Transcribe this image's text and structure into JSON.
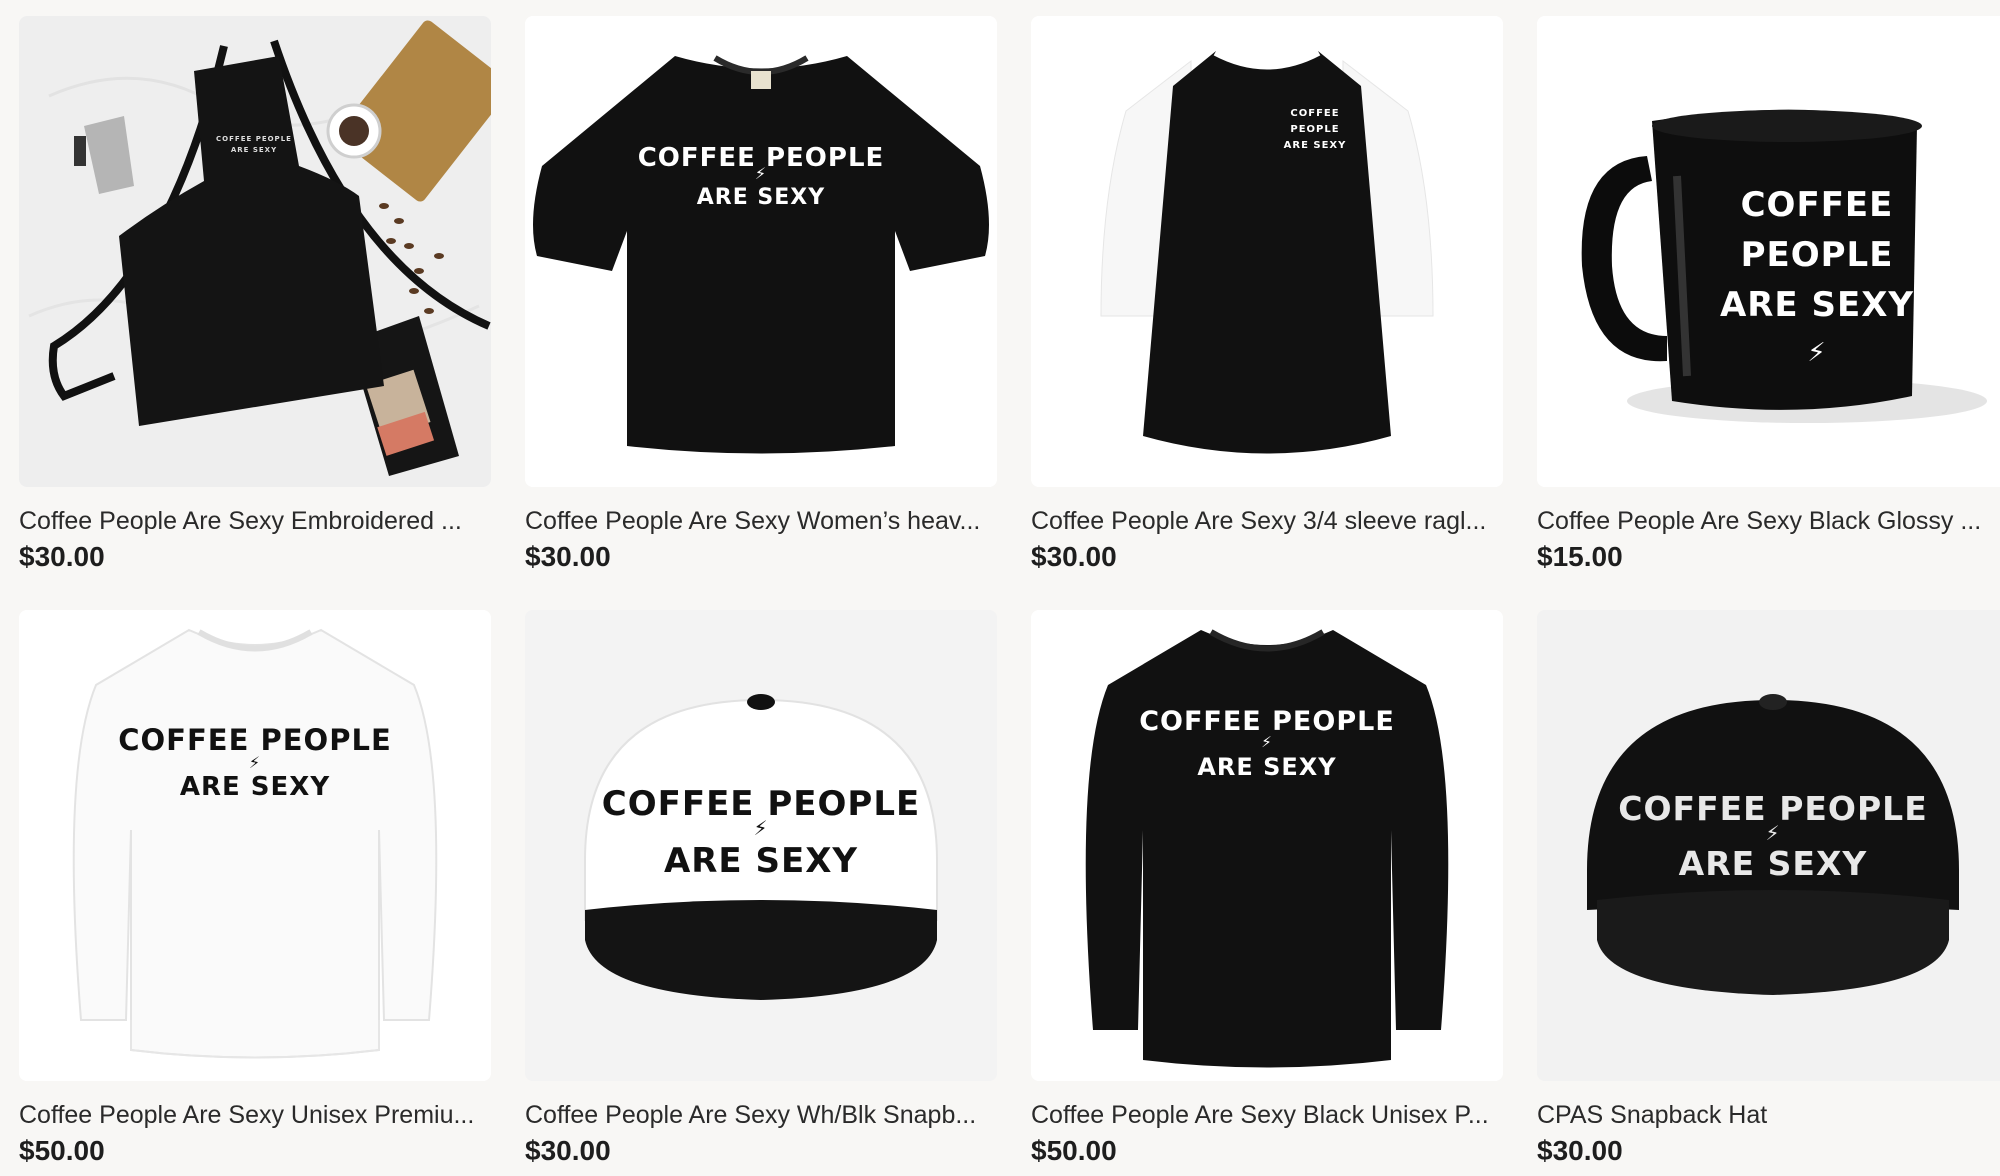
{
  "products": [
    {
      "title": "Coffee People Are Sexy Embroidered ...",
      "price": "$30.00",
      "icon": "apron-image",
      "print": [
        "COFFEE PEOPLE",
        "ARE SEXY"
      ]
    },
    {
      "title": "Coffee People Are Sexy Women’s heav...",
      "price": "$30.00",
      "icon": "tshirt-image",
      "print": [
        "COFFEE PEOPLE",
        "ARE SEXY"
      ]
    },
    {
      "title": "Coffee People Are Sexy 3/4 sleeve ragl...",
      "price": "$30.00",
      "icon": "raglan-shirt-image",
      "print": [
        "COFFEE",
        "PEOPLE",
        "ARE SEXY"
      ]
    },
    {
      "title": "Coffee People Are Sexy Black Glossy ...",
      "price": "$15.00",
      "icon": "mug-image",
      "print": [
        "COFFEE",
        "PEOPLE",
        "ARE SEXY"
      ]
    },
    {
      "title": "Coffee People Are Sexy Unisex Premiu...",
      "price": "$50.00",
      "icon": "white-sweatshirt-image",
      "print": [
        "COFFEE PEOPLE",
        "ARE SEXY"
      ]
    },
    {
      "title": "Coffee People Are Sexy Wh/Blk Snapb...",
      "price": "$30.00",
      "icon": "white-snapback-image",
      "print": [
        "COFFEE PEOPLE",
        "ARE SEXY"
      ]
    },
    {
      "title": "Coffee People Are Sexy Black Unisex P...",
      "price": "$50.00",
      "icon": "black-sweatshirt-image",
      "print": [
        "COFFEE PEOPLE",
        "ARE SEXY"
      ]
    },
    {
      "title": "CPAS Snapback Hat",
      "price": "$30.00",
      "icon": "black-snapback-image",
      "print": [
        "COFFEE PEOPLE",
        "ARE SEXY"
      ]
    }
  ],
  "colors": {
    "background": "#f8f7f5",
    "card": "#ffffff",
    "garment_black": "#111111",
    "garment_white": "#fafafa"
  }
}
